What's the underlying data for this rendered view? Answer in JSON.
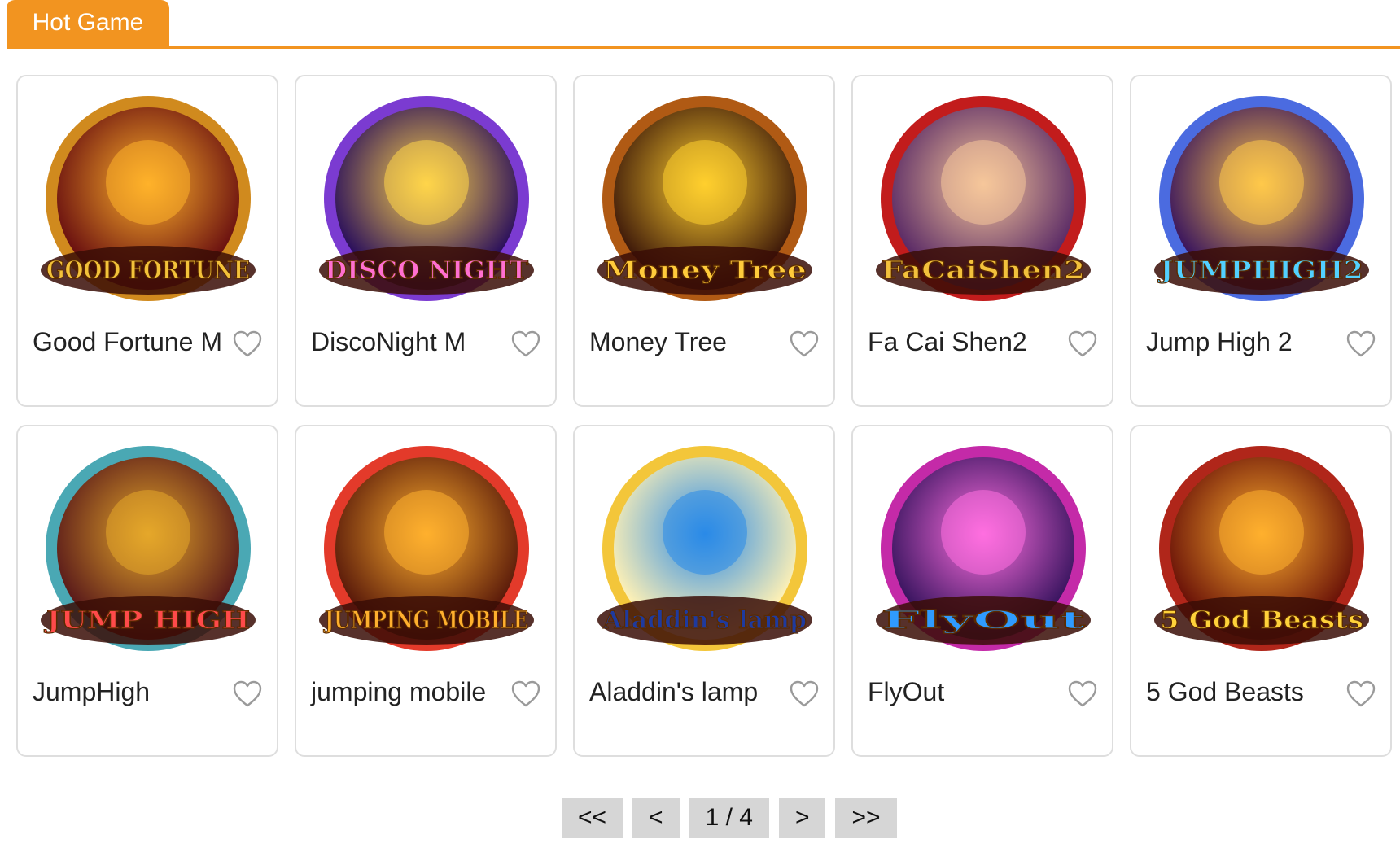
{
  "section": {
    "tab_label": "Hot Game"
  },
  "colors": {
    "accent": "#f29420"
  },
  "games": [
    {
      "name": "Good Fortune M",
      "logo_text": "GOOD FORTUNE",
      "ring": "#d08a1e",
      "inner": "#6a1010",
      "glow": "#ffb22a",
      "logo": "#f3c23a",
      "icon": "good-fortune-game-icon"
    },
    {
      "name": "DiscoNight M",
      "logo_text": "DISCO NIGHT",
      "ring": "#7b3bd1",
      "inner": "#2a0f5c",
      "glow": "#ffd54a",
      "logo": "#ff6fd1",
      "icon": "disco-night-game-icon"
    },
    {
      "name": "Money Tree",
      "logo_text": "Money Tree",
      "ring": "#b05a14",
      "inner": "#3f1a0a",
      "glow": "#ffcf2e",
      "logo": "#ffcb3b",
      "icon": "money-tree-game-icon"
    },
    {
      "name": "Fa Cai Shen2",
      "logo_text": "FaCaiShen2",
      "ring": "#c21c1c",
      "inner": "#5a2a66",
      "glow": "#f6c79a",
      "logo": "#f2c13c",
      "icon": "fa-cai-shen-game-icon"
    },
    {
      "name": "Jump High 2",
      "logo_text": "JUMPHIGH2",
      "ring": "#4b6be0",
      "inner": "#3a155e",
      "glow": "#ffc94a",
      "logo": "#52d0ff",
      "icon": "jump-high-2-game-icon"
    },
    {
      "name": "JumpHigh",
      "logo_text": "JUMP HIGH",
      "ring": "#4aa8b4",
      "inner": "#5a1a1a",
      "glow": "#e5a82a",
      "logo": "#ff4a4a",
      "icon": "jump-high-game-icon"
    },
    {
      "name": "jumping mobile",
      "logo_text": "JUMPING MOBILE",
      "ring": "#e33a2a",
      "inner": "#5a1a0a",
      "glow": "#ffb02e",
      "logo": "#ffb02e",
      "icon": "jumping-mobile-game-icon"
    },
    {
      "name": "Aladdin's lamp",
      "logo_text": "Aladdin's lamp",
      "ring": "#f3c63a",
      "inner": "#fff1b5",
      "glow": "#2a8ae8",
      "logo": "#1f3a9e",
      "icon": "aladdins-lamp-game-icon"
    },
    {
      "name": "FlyOut",
      "logo_text": "FlyOut",
      "ring": "#c42aa8",
      "inner": "#3a1560",
      "glow": "#ff6fe0",
      "logo": "#2f9bff",
      "icon": "flyout-game-icon"
    },
    {
      "name": "5 God Beasts",
      "logo_text": "5 God Beasts",
      "ring": "#b0261a",
      "inner": "#6a1208",
      "glow": "#ffb02e",
      "logo": "#ffd23a",
      "icon": "five-god-beasts-game-icon"
    }
  ],
  "pagination": {
    "first": "<<",
    "prev": "<",
    "info": "1 / 4",
    "next": ">",
    "last": ">>"
  }
}
